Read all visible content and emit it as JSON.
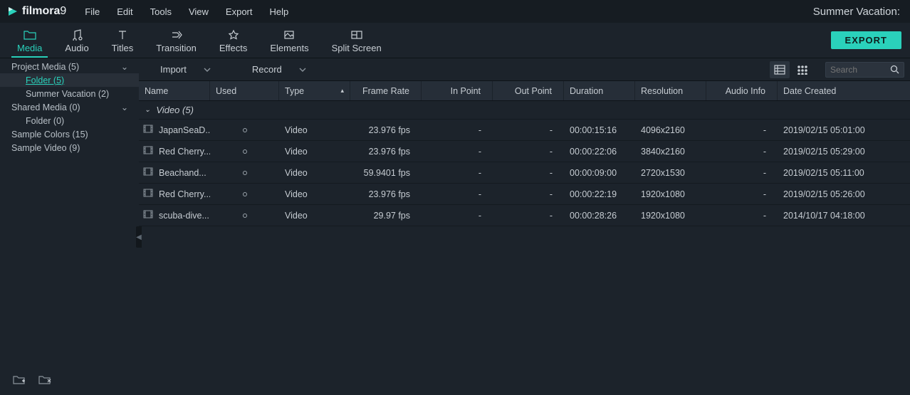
{
  "brand": {
    "name": "filmora",
    "version": "9"
  },
  "menu": {
    "file": "File",
    "edit": "Edit",
    "tools": "Tools",
    "view": "View",
    "export": "Export",
    "help": "Help"
  },
  "project_title": "Summer Vacation:",
  "tooltabs": {
    "media": "Media",
    "audio": "Audio",
    "titles": "Titles",
    "transition": "Transition",
    "effects": "Effects",
    "elements": "Elements",
    "split_screen": "Split Screen"
  },
  "export_button": "EXPORT",
  "sidebar": {
    "items": {
      "project_media": "Project Media (5)",
      "folder5": "Folder (5)",
      "summer_vacation": "Summer Vacation (2)",
      "shared_media": "Shared Media (0)",
      "folder0": "Folder (0)",
      "sample_colors": "Sample Colors (15)",
      "sample_video": "Sample Video (9)"
    }
  },
  "toolbar": {
    "import": "Import",
    "record": "Record"
  },
  "search": {
    "placeholder": "Search"
  },
  "headers": {
    "name": "Name",
    "used": "Used",
    "type": "Type",
    "fps": "Frame Rate",
    "in": "In Point",
    "out": "Out Point",
    "duration": "Duration",
    "resolution": "Resolution",
    "audio": "Audio Info",
    "date": "Date Created"
  },
  "group": {
    "label": "Video (5)"
  },
  "rows": [
    {
      "name": "JapanSeaD...",
      "used": "",
      "type": "Video",
      "fps": "23.976 fps",
      "in": "-",
      "out": "-",
      "duration": "00:00:15:16",
      "resolution": "4096x2160",
      "audio": "-",
      "date": "2019/02/15 05:01:00"
    },
    {
      "name": "Red Cherry...",
      "used": "",
      "type": "Video",
      "fps": "23.976 fps",
      "in": "-",
      "out": "-",
      "duration": "00:00:22:06",
      "resolution": "3840x2160",
      "audio": "-",
      "date": "2019/02/15 05:29:00"
    },
    {
      "name": "Beachand...",
      "used": "",
      "type": "Video",
      "fps": "59.9401 fps",
      "in": "-",
      "out": "-",
      "duration": "00:00:09:00",
      "resolution": "2720x1530",
      "audio": "-",
      "date": "2019/02/15 05:11:00"
    },
    {
      "name": "Red Cherry...",
      "used": "",
      "type": "Video",
      "fps": "23.976 fps",
      "in": "-",
      "out": "-",
      "duration": "00:00:22:19",
      "resolution": "1920x1080",
      "audio": "-",
      "date": "2019/02/15 05:26:00"
    },
    {
      "name": "scuba-dive...",
      "used": "",
      "type": "Video",
      "fps": "29.97 fps",
      "in": "-",
      "out": "-",
      "duration": "00:00:28:26",
      "resolution": "1920x1080",
      "audio": "-",
      "date": "2014/10/17 04:18:00"
    }
  ]
}
